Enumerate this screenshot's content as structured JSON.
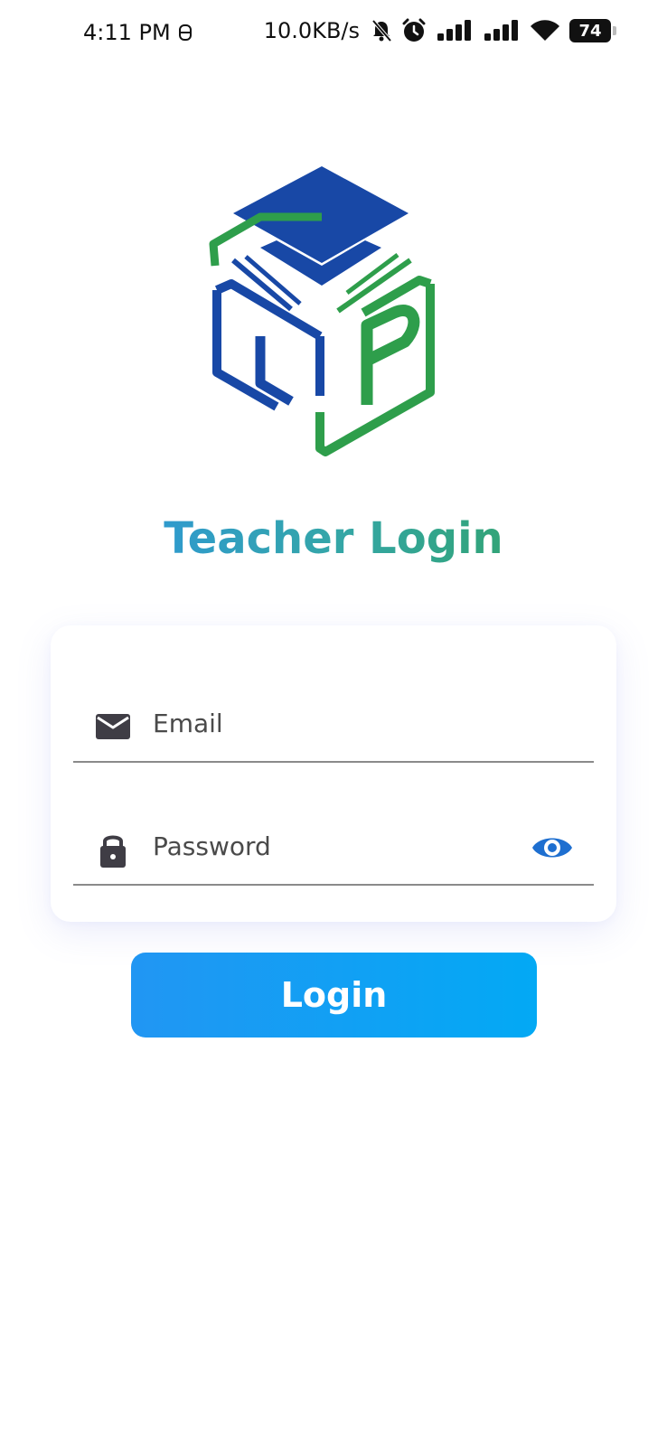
{
  "status_bar": {
    "time": "4:11 PM",
    "network_speed": "10.0KB/s",
    "battery": "74"
  },
  "header": {
    "title": "Teacher Login"
  },
  "form": {
    "email_placeholder": "Email",
    "password_placeholder": "Password",
    "login_label": "Login"
  },
  "icons": {
    "email": "mail-icon",
    "password": "lock-icon",
    "toggle": "eye-icon"
  },
  "colors": {
    "brand_blue": "#1848a6",
    "brand_green": "#2e9e4b",
    "button_start": "#2196f3",
    "button_end": "#03a9f4",
    "eye_icon": "#1e6fd0"
  }
}
